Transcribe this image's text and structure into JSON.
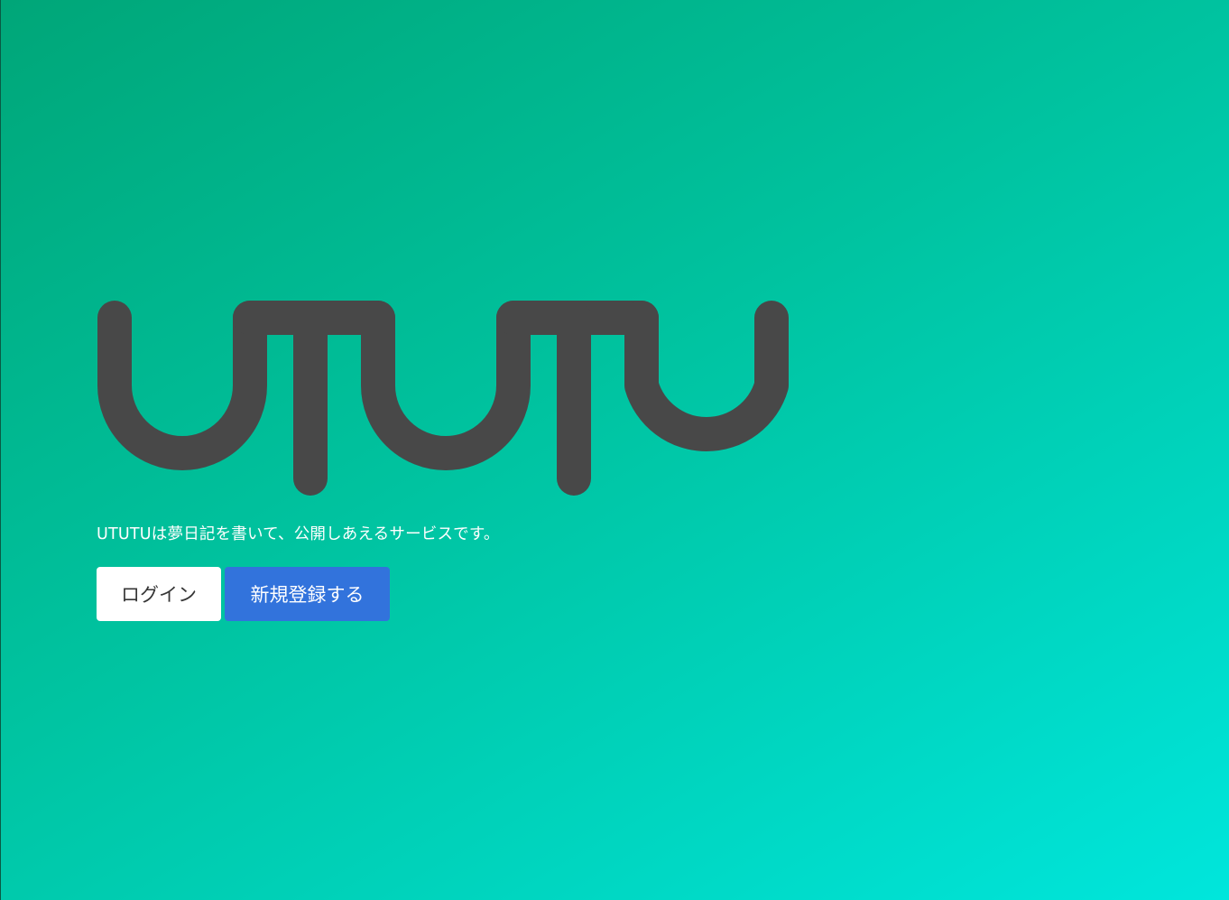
{
  "logo": {
    "text": "UTUTU",
    "color": "#484848"
  },
  "tagline": "UTUTUは夢日記を書いて、公開しあえるサービスです。",
  "actions": {
    "login_label": "ログイン",
    "signup_label": "新規登録する"
  },
  "colors": {
    "gradient_start": "#00a678",
    "gradient_end": "#00e6dc",
    "primary_button": "#3273dc",
    "login_button": "#ffffff",
    "text_dark": "#363636"
  }
}
